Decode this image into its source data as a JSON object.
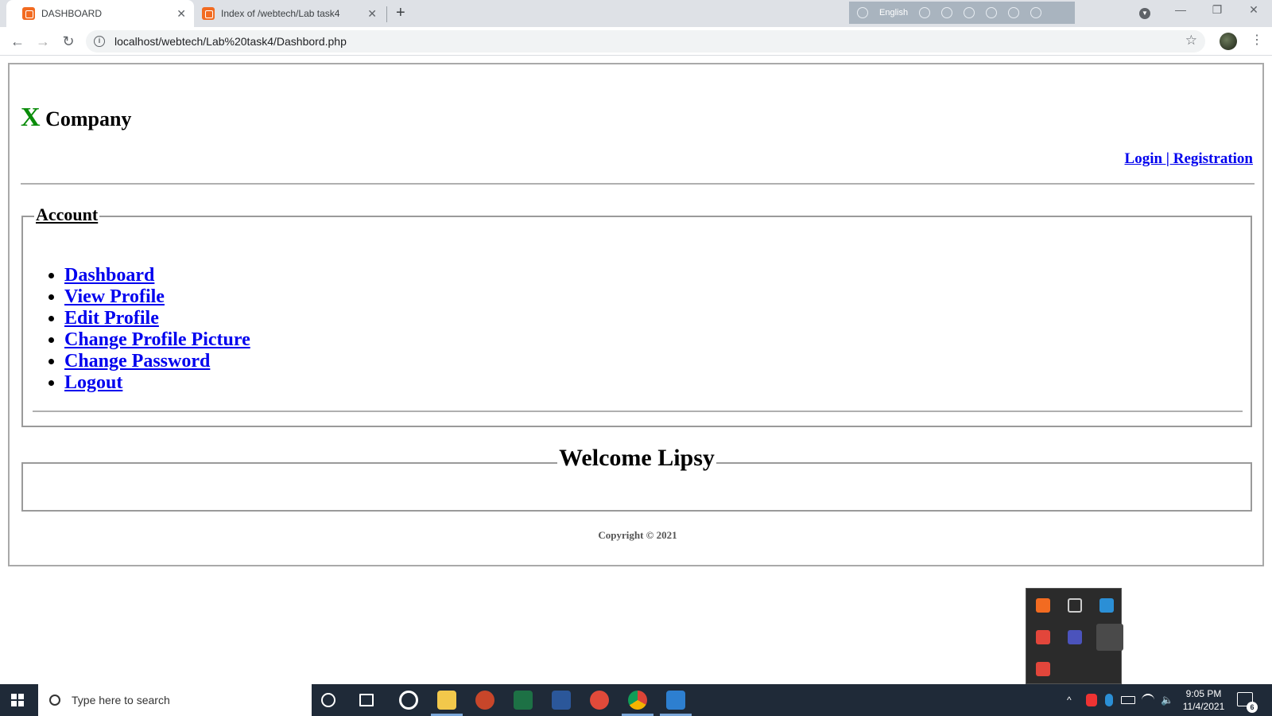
{
  "browser": {
    "tabs": [
      {
        "title": "DASHBOARD",
        "active": true
      },
      {
        "title": "Index of /webtech/Lab task4",
        "active": false
      }
    ],
    "new_tab_label": "+",
    "ime_language": "English",
    "url": "localhost/webtech/Lab%20task4/Dashbord.php"
  },
  "page": {
    "brand_x": "X",
    "brand_name": "Company",
    "auth_links": "Login | Registration",
    "account": {
      "legend": "Account",
      "items": [
        "Dashboard",
        "View Profile",
        "Edit Profile",
        "Change Profile Picture",
        "Change Password",
        "Logout"
      ]
    },
    "welcome": "Welcome Lipsy",
    "copyright": "Copyright © 2021"
  },
  "taskbar": {
    "search_placeholder": "Type here to search",
    "time": "9:05 PM",
    "date": "11/4/2021",
    "notification_count": "6"
  },
  "colors": {
    "link": "#0000ee",
    "brand_x": "#0a8c0a",
    "taskbar_bg": "#1f2a38"
  }
}
